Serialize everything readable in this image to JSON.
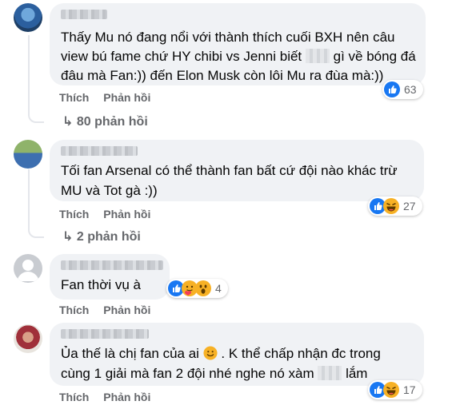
{
  "comments": [
    {
      "lines": [
        "Thấy Mu nó đang nổi với thành thích cuối BXH nên câu",
        "view bú fame chứ HY chibi vs Jenni biết",
        "gì về bóng đá",
        "đâu mà Fan:)) đến Elon Musk còn lôi Mu ra đùa mà:))"
      ],
      "like_label": "Thích",
      "reply_label": "Phản hồi",
      "reaction_count": "63",
      "reaction_icons": [
        "like-icon"
      ],
      "replies_label": "80 phản hồi"
    },
    {
      "lines": [
        "Tối fan Arsenal có thể thành fan bất cứ đội nào khác trừ",
        "MU và Tot gà :))"
      ],
      "like_label": "Thích",
      "reply_label": "Phản hồi",
      "reaction_count": "27",
      "reaction_icons": [
        "like-icon",
        "haha-icon"
      ],
      "replies_label": "2 phản hồi"
    },
    {
      "lines": [
        "Fan thời vụ à"
      ],
      "like_label": "Thích",
      "reply_label": "Phản hồi",
      "reaction_count": "4",
      "reaction_icons": [
        "like-icon",
        "care-icon",
        "wow-icon"
      ]
    },
    {
      "lines": [
        "Ủa thế là chị fan của ai",
        ". K thể chấp nhận đc trong",
        "cùng 1 giải mà fan 2 đội nhé nghe nó xàm",
        "lắm"
      ],
      "like_label": "Thích",
      "reply_label": "Phản hồi",
      "reaction_count": "17",
      "reaction_icons": [
        "like-icon",
        "haha-icon"
      ]
    }
  ],
  "colors": {
    "bubble": "#f0f2f5",
    "secondary_text": "#65676b",
    "like_blue": "#1877f2",
    "emoji_yellow": "#f7b125"
  }
}
